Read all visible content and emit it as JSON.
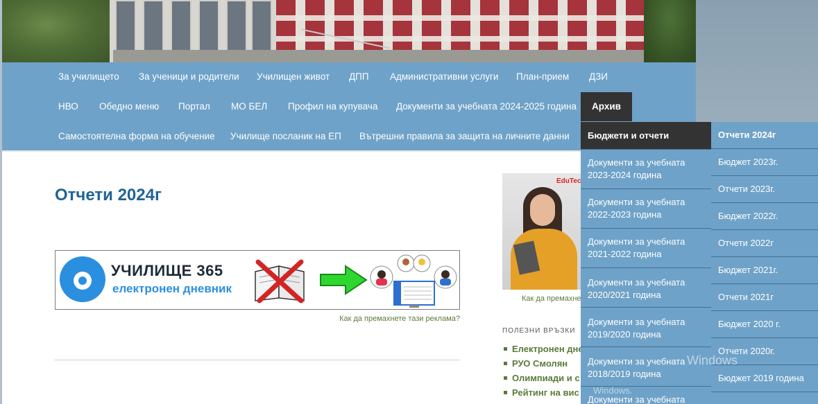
{
  "nav": {
    "row1": [
      "За училището",
      "За ученици и родители",
      "Училищен живот",
      "ДПП",
      "Административни услуги",
      "План-прием",
      "ДЗИ"
    ],
    "row2": [
      "НВО",
      "Обедно меню",
      "Портал",
      "МО БЕЛ",
      "Профил на купувача",
      "Документи за учебната 2024-2025 година",
      "Архив"
    ],
    "row3": [
      "Самостоятелна форма на обучение",
      "Училище посланик на ЕП",
      "Вътрешни правила за защита на личните данни"
    ]
  },
  "dropdown": {
    "level1": [
      "Бюджети и отчети",
      "Документи за учебната 2023-2024 година",
      "Документи за учебната 2022-2023 година",
      "Документи за учебната 2021-2022 година",
      "Документи за учебната 2020/2021 година",
      "Документи за учебната 2019/2020 година",
      "Документи за учебната 2018/2019 година",
      "Документи за учебната"
    ],
    "level2": [
      "Отчети 2024г",
      "Бюджет 2023г.",
      "Отчети 2023г.",
      "Бюджет 2022г.",
      "Отчети 2022г",
      "Бюджет 2021г.",
      "Отчети 2021г",
      "Бюджет 2020 г.",
      "Отчети 2020г.",
      "Бюджет 2019 година"
    ]
  },
  "page": {
    "title": "Отчети 2024г",
    "banner_main": "УЧИЛИЩЕ 365",
    "banner_sub": "електронен дневник",
    "ad_note": "Как да премахнете тази реклама?",
    "ad_note_side": "Как да премахне",
    "sidebar_brand": "EduTech"
  },
  "sidebar": {
    "links_title": "ПОЛЕЗНИ ВРЪЗКИ",
    "links": [
      "Електронен дне",
      "РУО Смолян",
      "Олимпиади и с",
      "Рейтинг на вис"
    ]
  },
  "watermark": {
    "line1": "Windows",
    "line2": "Windows."
  },
  "colors": {
    "nav_bg": "#6fa2c8",
    "active_bg": "#333333",
    "title": "#1f6496",
    "link": "#5a7a3a"
  }
}
